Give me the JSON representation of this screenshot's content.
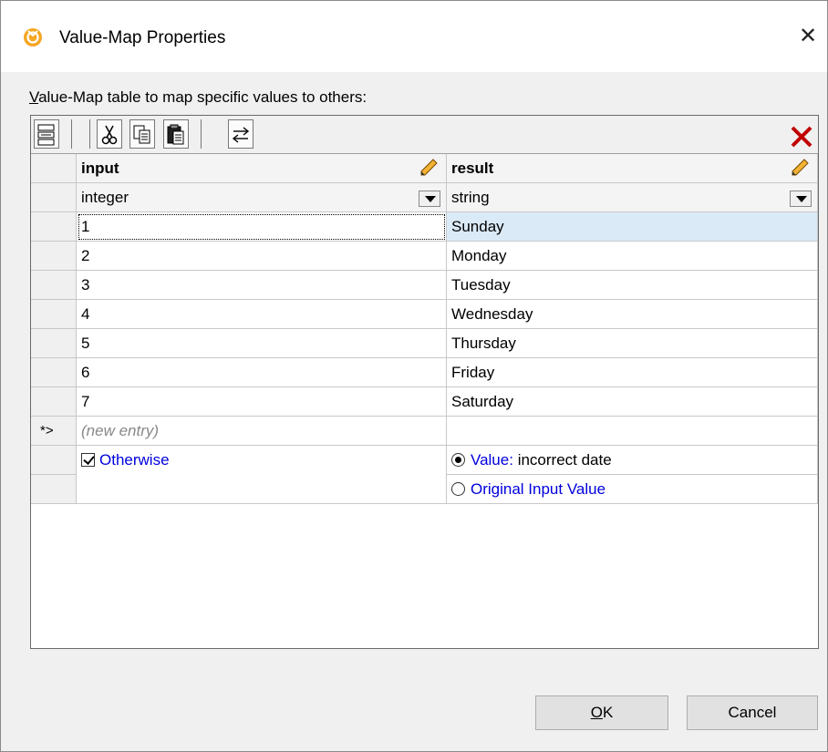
{
  "window": {
    "title": "Value-Map Properties",
    "close_glyph": "✕"
  },
  "description": {
    "mnemonic": "V",
    "rest": "alue-Map table to map specific values to others:"
  },
  "toolbar": {
    "icons": [
      "insert-row-icon",
      "cut-icon",
      "copy-icon",
      "paste-icon",
      "swap-columns-icon",
      "delete-row-icon"
    ]
  },
  "columns": {
    "input": {
      "header": "input",
      "type": "integer"
    },
    "result": {
      "header": "result",
      "type": "string"
    }
  },
  "rows": [
    {
      "input": "1",
      "result": "Sunday"
    },
    {
      "input": "2",
      "result": "Monday"
    },
    {
      "input": "3",
      "result": "Tuesday"
    },
    {
      "input": "4",
      "result": "Wednesday"
    },
    {
      "input": "5",
      "result": "Thursday"
    },
    {
      "input": "6",
      "result": "Friday"
    },
    {
      "input": "7",
      "result": "Saturday"
    }
  ],
  "new_entry": {
    "marker": "*>",
    "placeholder": "(new entry)"
  },
  "otherwise": {
    "label": "Otherwise",
    "checked": true,
    "value_option": {
      "label": "Value:",
      "value": "incorrect date",
      "selected": true
    },
    "original_option": {
      "label": "Original Input Value",
      "selected": false
    }
  },
  "buttons": {
    "ok_mnemonic": "O",
    "ok_rest": "K",
    "cancel": "Cancel"
  },
  "colors": {
    "selection_bg": "#dbeaf7",
    "link_blue": "#0000dd",
    "delete_red": "#c00000",
    "app_icon": "#f5a623"
  }
}
